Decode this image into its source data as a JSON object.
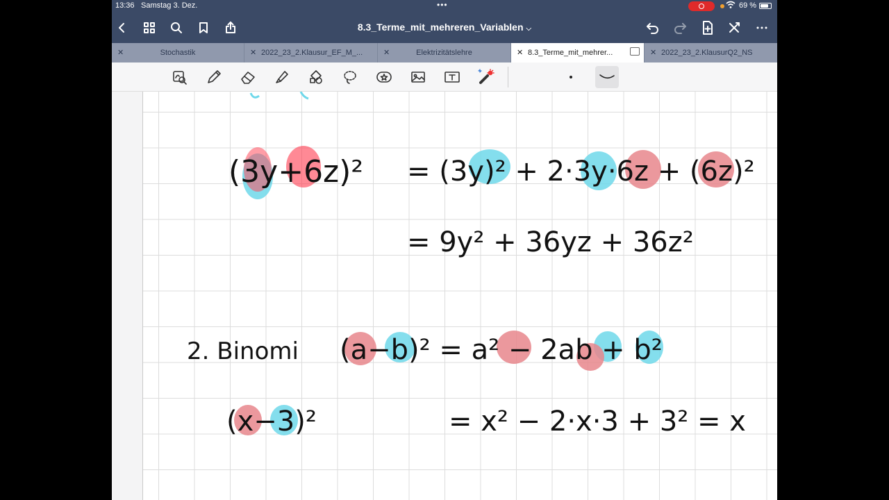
{
  "status_bar": {
    "time": "13:36",
    "date": "Samstag 3. Dez.",
    "battery": "69 %"
  },
  "nav": {
    "title": "8.3_Terme_mit_mehreren_Variablen"
  },
  "tabs": [
    {
      "label": "Stochastik",
      "active": false
    },
    {
      "label": "2022_23_2.Klausur_EF_M_...",
      "active": false
    },
    {
      "label": "Elektrizitätslehre",
      "active": false
    },
    {
      "label": "8.3_Terme_mit_mehrer...",
      "active": true
    },
    {
      "label": "2022_23_2.KlausurQ2_NS",
      "active": false
    }
  ],
  "colors": {
    "chrome": "#3b4a66",
    "tabbar": "#9099ad",
    "highlight_red": "#e8868c",
    "highlight_blue": "#6fd8ea",
    "ink": "#111111"
  },
  "notes": {
    "eq1_lhs": "(3y+6z)²",
    "eq1_rhs": "= (3y)² + 2·3y·6z + (6z)²",
    "eq1_result": "= 9y² + 36yz + 36z²",
    "binomi_label": "2. Binomi",
    "binomi_formula": "(a−b)² = a² − 2ab + b²",
    "eq2_lhs": "(x−3)²",
    "eq2_rhs": "= x² − 2·x·3 + 3² = x"
  }
}
